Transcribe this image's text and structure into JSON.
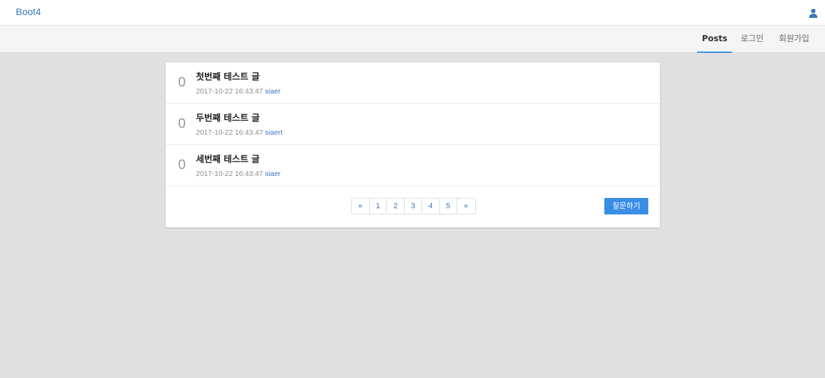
{
  "header": {
    "brand": "Boot4",
    "user_icon": "user-icon"
  },
  "nav": {
    "items": [
      {
        "label": "Posts",
        "active": true
      },
      {
        "label": "로그인",
        "active": false
      },
      {
        "label": "회원가입",
        "active": false
      }
    ]
  },
  "posts": [
    {
      "count": "0",
      "title": "첫번째 테스트 글",
      "date": "2017-10-22 16:43:47",
      "author": "siaer"
    },
    {
      "count": "0",
      "title": "두번째 테스트 글",
      "date": "2017-10-22 16:43:47",
      "author": "siaert"
    },
    {
      "count": "0",
      "title": "세번째 테스트 글",
      "date": "2017-10-22 16:43:47",
      "author": "siaer"
    }
  ],
  "pagination": {
    "prev": "«",
    "pages": [
      "1",
      "2",
      "3",
      "4",
      "5"
    ],
    "next": "»"
  },
  "actions": {
    "ask_label": "질문하기"
  },
  "colors": {
    "accent": "#3a8ee6",
    "link": "#3a76b8",
    "background": "#e0e0e0"
  }
}
